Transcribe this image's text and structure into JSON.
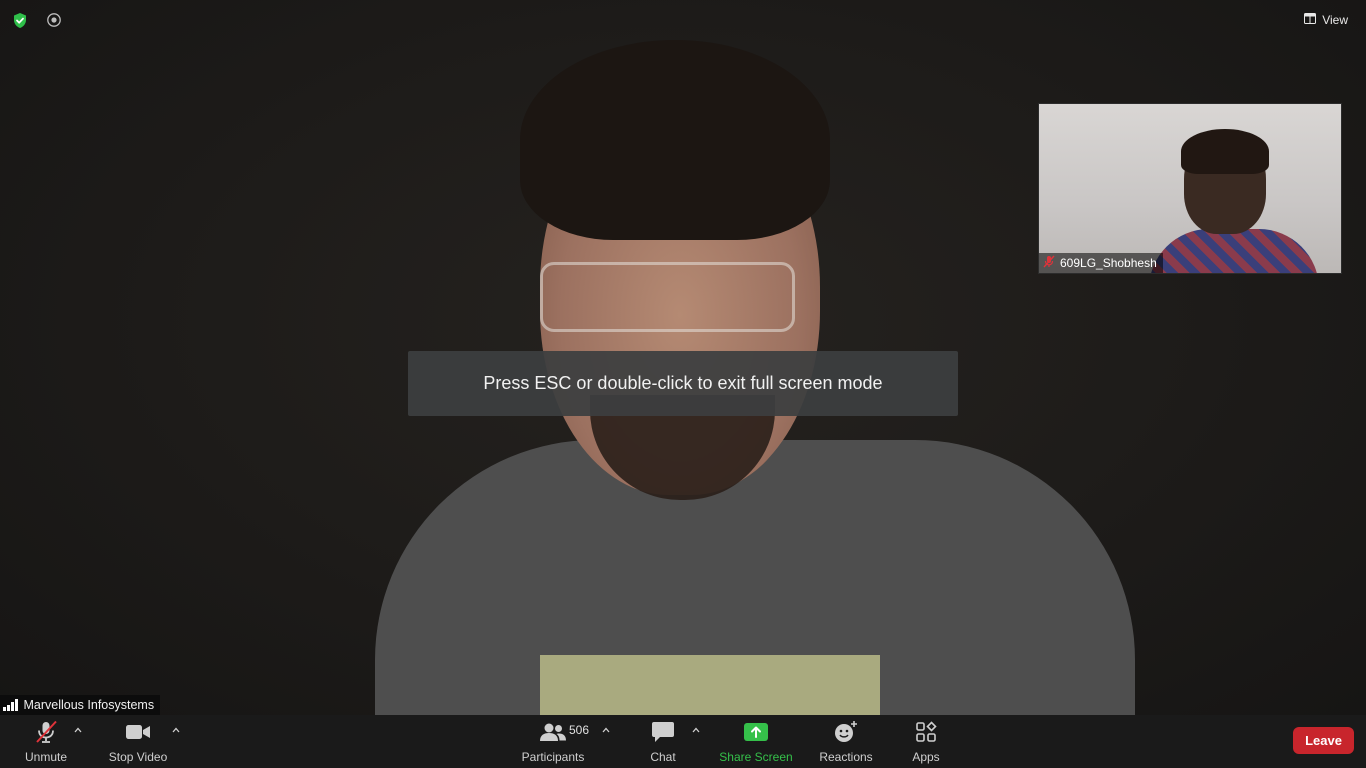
{
  "meeting": {
    "security_icon": "shield-check-icon",
    "recording_icon": "record-icon",
    "view_label": "View",
    "view_icon": "grid-icon"
  },
  "main_video": {
    "speaker_name": "Marvellous Infosystems"
  },
  "thumbnail": {
    "participant_name": "609LG_Shobhesh",
    "muted_icon": "mic-muted-icon"
  },
  "toast": {
    "message": "Press ESC or double-click to exit full screen mode"
  },
  "toolbar": {
    "unmute_label": "Unmute",
    "stop_video_label": "Stop Video",
    "participants_label": "Participants",
    "participants_count": "506",
    "chat_label": "Chat",
    "share_screen_label": "Share Screen",
    "reactions_label": "Reactions",
    "apps_label": "Apps",
    "leave_label": "Leave"
  },
  "colors": {
    "accent_green": "#35c04a",
    "leave_red": "#c8252c",
    "muted_red": "#e0333a"
  }
}
